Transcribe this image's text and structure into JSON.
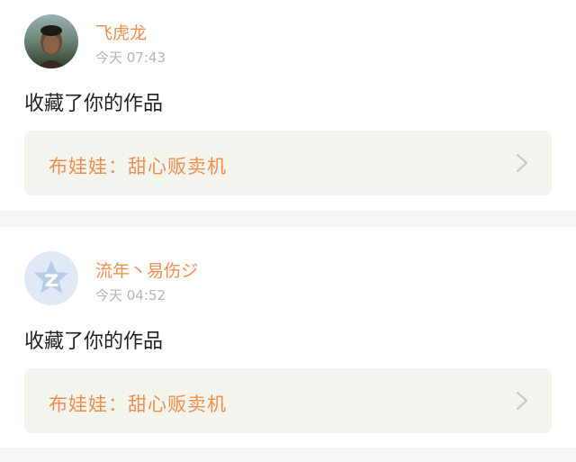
{
  "feed": {
    "items": [
      {
        "user": "飞虎龙",
        "time": "今天 07:43",
        "action": "收藏了你的作品",
        "work_title": "布娃娃：甜心贩卖机"
      },
      {
        "user": "流年丶易伤ジ",
        "time": "今天 04:52",
        "action": "收藏了你的作品",
        "work_title": "布娃娃：甜心贩卖机"
      }
    ]
  },
  "colors": {
    "accent": "#ee8f4f",
    "time_gray": "#b5b5b5",
    "box_bg": "#f4f4ee",
    "separator": "#f6f6f6"
  },
  "icons": {
    "avatar_1": "user-photo-avatar",
    "avatar_2": "default-qzone-avatar",
    "chevron": "chevron-right-icon"
  }
}
